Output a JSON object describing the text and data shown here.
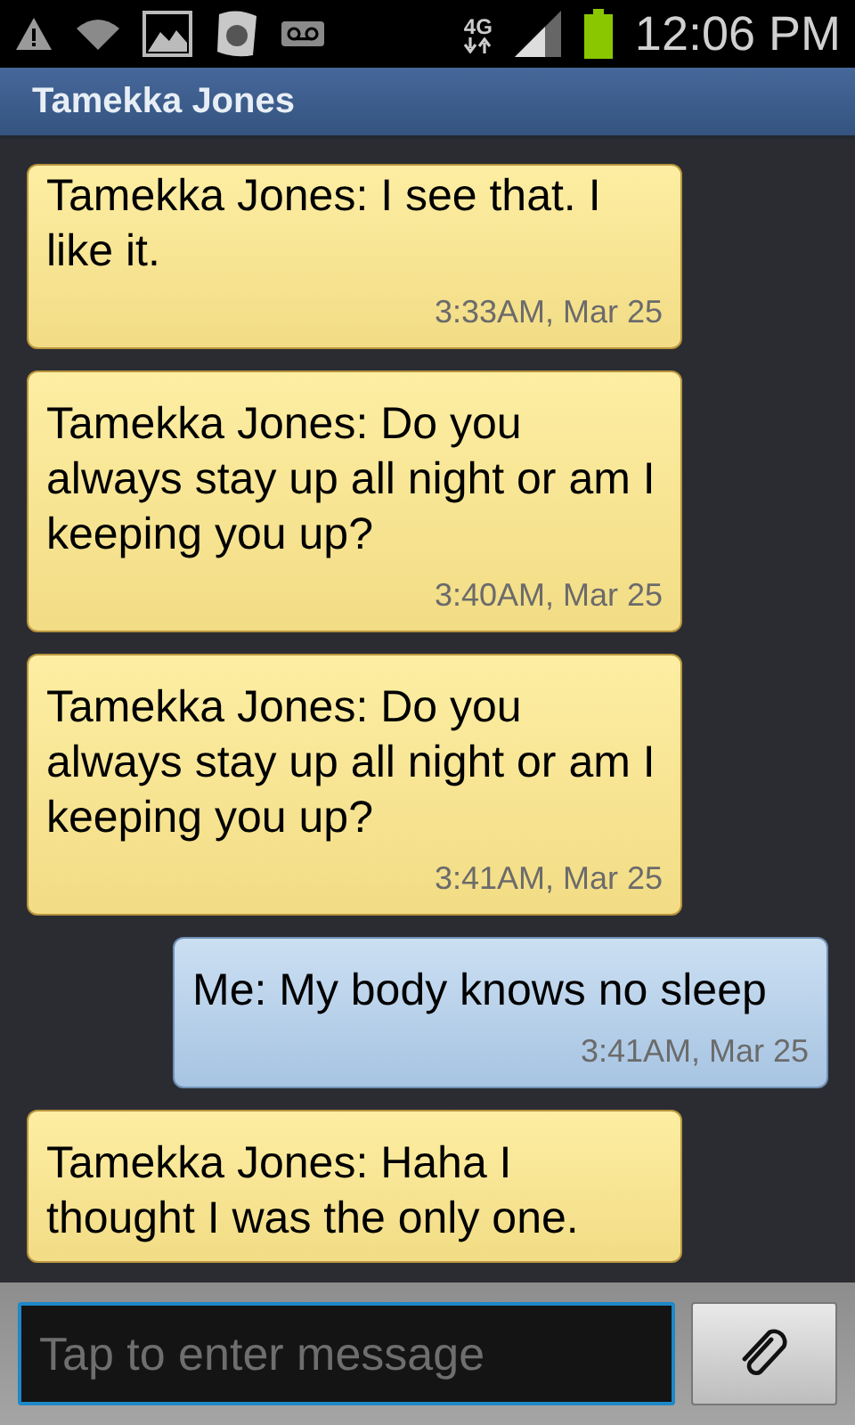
{
  "status_bar": {
    "network": "4G",
    "time": "12:06 PM"
  },
  "header": {
    "title": "Tamekka Jones"
  },
  "messages": [
    {
      "kind": "incoming",
      "text": "Tamekka Jones: I see that. I like it.",
      "time": "3:33AM, Mar 25"
    },
    {
      "kind": "incoming",
      "text": "Tamekka Jones: Do you always stay up all night or am I keeping you up?",
      "time": "3:40AM, Mar 25"
    },
    {
      "kind": "incoming",
      "text": "Tamekka Jones: Do you always stay up all night or am I keeping you up?",
      "time": "3:41AM, Mar 25"
    },
    {
      "kind": "outgoing",
      "text": "Me: My body knows no sleep",
      "time": "3:41AM, Mar 25"
    },
    {
      "kind": "incoming",
      "text": "Tamekka Jones: Haha I thought I was the only one."
    }
  ],
  "composer": {
    "placeholder": "Tap to enter message"
  }
}
